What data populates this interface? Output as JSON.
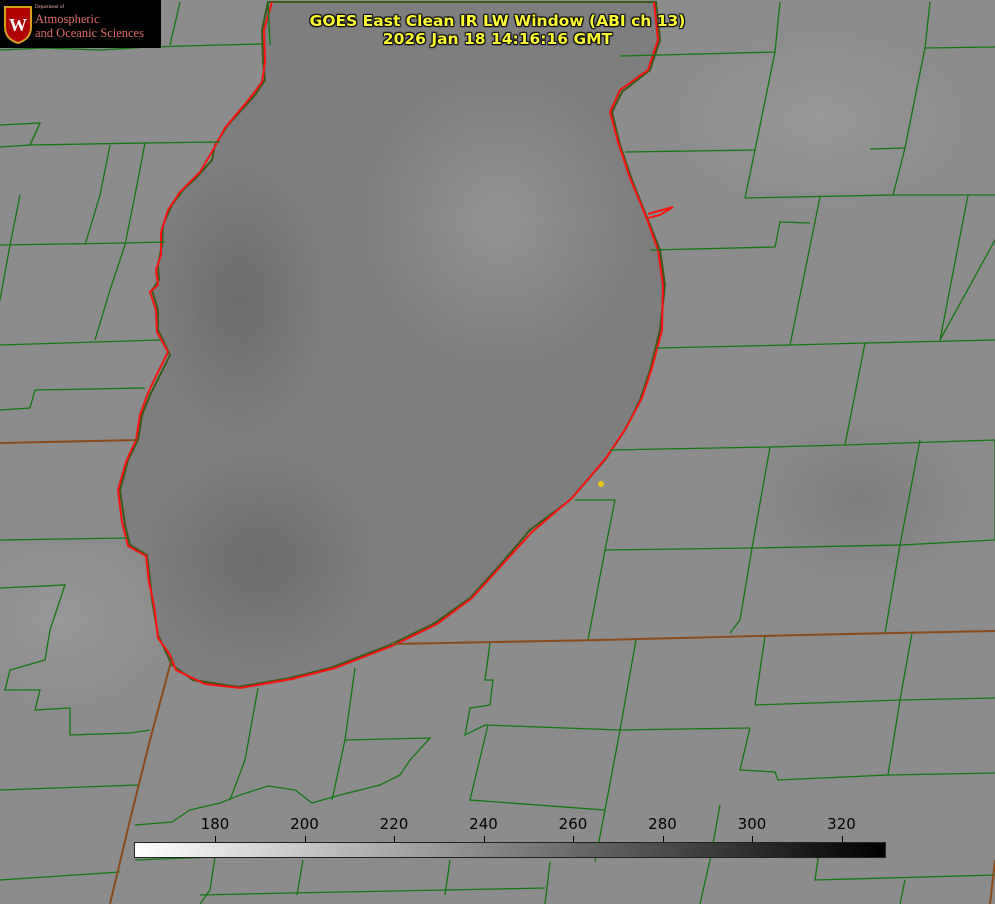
{
  "title": {
    "line1": "GOES East Clean IR LW Window (ABI ch 13)",
    "line2": "2026 Jan 18 14:16:16 GMT"
  },
  "logo": {
    "dept": "Department of",
    "line1": "Atmospheric",
    "line2": "and Oceanic Sciences",
    "seal_letter": "W"
  },
  "colorbar": {
    "ticks": [
      "180",
      "200",
      "220",
      "240",
      "260",
      "280",
      "300",
      "320"
    ],
    "min_color": "#ffffff",
    "max_color": "#000000"
  },
  "colors": {
    "county_lines": "#117711",
    "state_lines": "#8a4a1a",
    "shoreline": "#ff1111",
    "title_text": "#ffff33",
    "marker": "#e6c619"
  }
}
